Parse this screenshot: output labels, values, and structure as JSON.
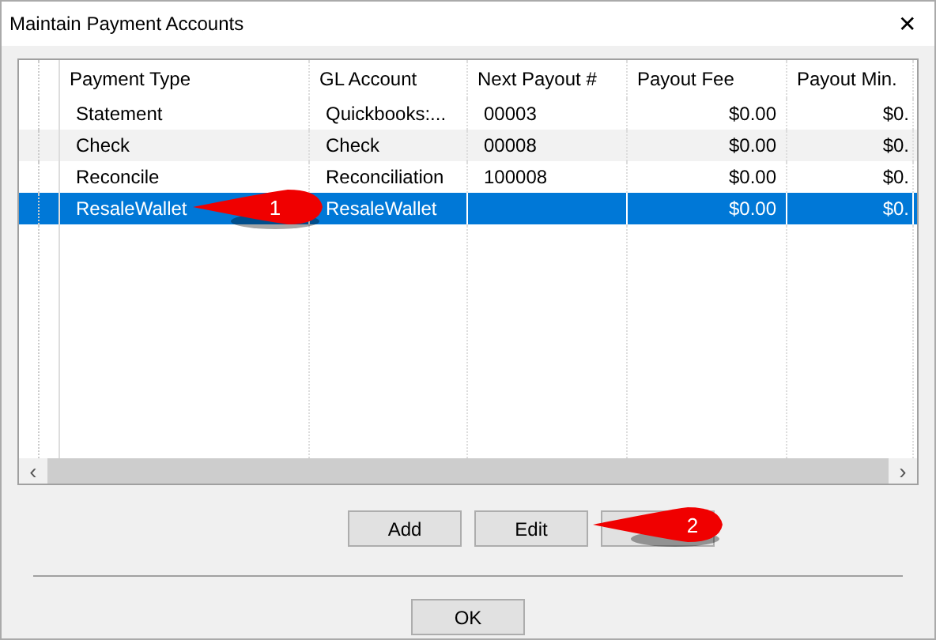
{
  "window": {
    "title": "Maintain Payment Accounts",
    "close": "✕"
  },
  "table": {
    "columns": [
      "Payment Type",
      "GL Account",
      "Next Payout #",
      "Payout Fee",
      "Payout Min."
    ],
    "rows": [
      {
        "cells": [
          "Statement",
          "Quickbooks:...",
          "00003",
          "$0.00",
          "$0."
        ],
        "selected": false
      },
      {
        "cells": [
          "Check",
          " Check",
          "00008",
          "$0.00",
          "$0."
        ],
        "selected": false
      },
      {
        "cells": [
          "Reconcile",
          "Reconciliation",
          "100008",
          "$0.00",
          "$0."
        ],
        "selected": false
      },
      {
        "cells": [
          "ResaleWallet",
          "ResaleWallet",
          "",
          "$0.00",
          "$0."
        ],
        "selected": true
      }
    ],
    "scroll_left": "‹",
    "scroll_right": "›"
  },
  "buttons": [
    "Add",
    "Edit"
  ],
  "covered_button": true,
  "ok_button": "OK",
  "callouts": [
    {
      "number": "1"
    },
    {
      "number": "2"
    }
  ]
}
